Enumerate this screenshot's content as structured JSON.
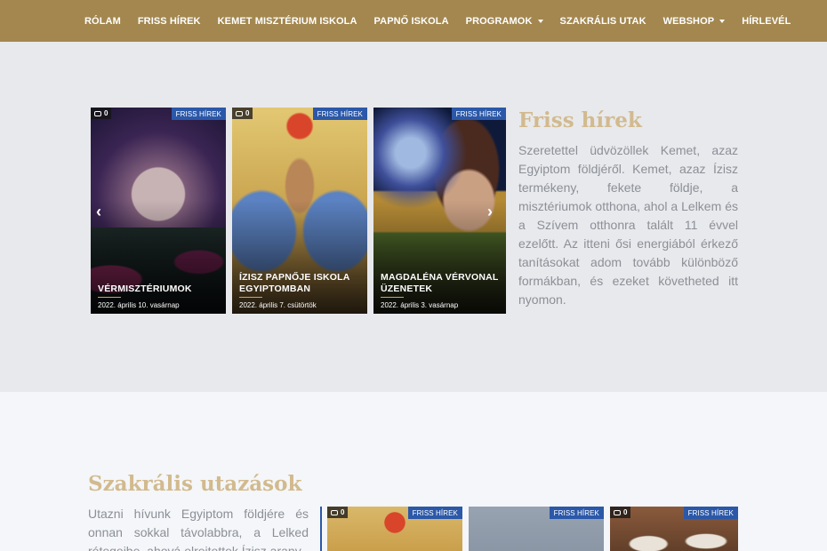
{
  "nav": {
    "items": [
      {
        "label": "RÓLAM",
        "dropdown": false
      },
      {
        "label": "FRISS HÍREK",
        "dropdown": false
      },
      {
        "label": "KEMET MISZTÉRIUM ISKOLA",
        "dropdown": false
      },
      {
        "label": "PAPNŐ ISKOLA",
        "dropdown": false
      },
      {
        "label": "PROGRAMOK",
        "dropdown": true
      },
      {
        "label": "SZAKRÁLIS UTAK",
        "dropdown": false
      },
      {
        "label": "WEBSHOP",
        "dropdown": true
      },
      {
        "label": "HÍRLEVÉL",
        "dropdown": false
      }
    ],
    "bg_color": "#a3874f"
  },
  "news": {
    "title": "Friss hírek",
    "text": "Szeretettel üdvözöllek Kemet, azaz Egyiptom földjéről. Kemet, azaz Ízisz termékeny, fekete földje, a misztériumok otthona, ahol a Lelkem és a Szívem otthonra  talált 11 évvel ezelőtt. Az itteni ősi energiából érkező tanításokat adom tovább különböző formákban, és ezeket követheted itt nyomon.",
    "cards": [
      {
        "badge": "FRISS HÍREK",
        "comments": "0",
        "title": "VÉRMISZTÉRIUMOK",
        "date": "2022. április 10. vasárnap"
      },
      {
        "badge": "FRISS HÍREK",
        "comments": "0",
        "title": "ÍZISZ PAPNŐJE ISKOLA EGYIPTOMBAN",
        "date": "2022. április 7. csütörtök"
      },
      {
        "badge": "FRISS HÍREK",
        "comments": "0",
        "title": "MAGDALÉNA VÉRVONAL ÜZENETEK",
        "date": "2022. április 3. vasárnap"
      }
    ],
    "prev_icon": "chevron-left-icon",
    "next_icon": "chevron-right-icon"
  },
  "travel": {
    "title": "Szakrális utazások",
    "text": "Utazni hívunk Egyiptom földjére és onnan sokkal távolabbra, a Lelked rétegeibe, ahová elrejtettek Ízisz arany",
    "cards": [
      {
        "badge": "FRISS HÍREK",
        "comments": "0"
      },
      {
        "badge": "FRISS HÍREK",
        "comments": ""
      },
      {
        "badge": "FRISS HÍREK",
        "comments": "0"
      }
    ]
  },
  "colors": {
    "accent": "#d2ba8e",
    "badge": "#2b58a8",
    "text": "#8c8f97"
  }
}
